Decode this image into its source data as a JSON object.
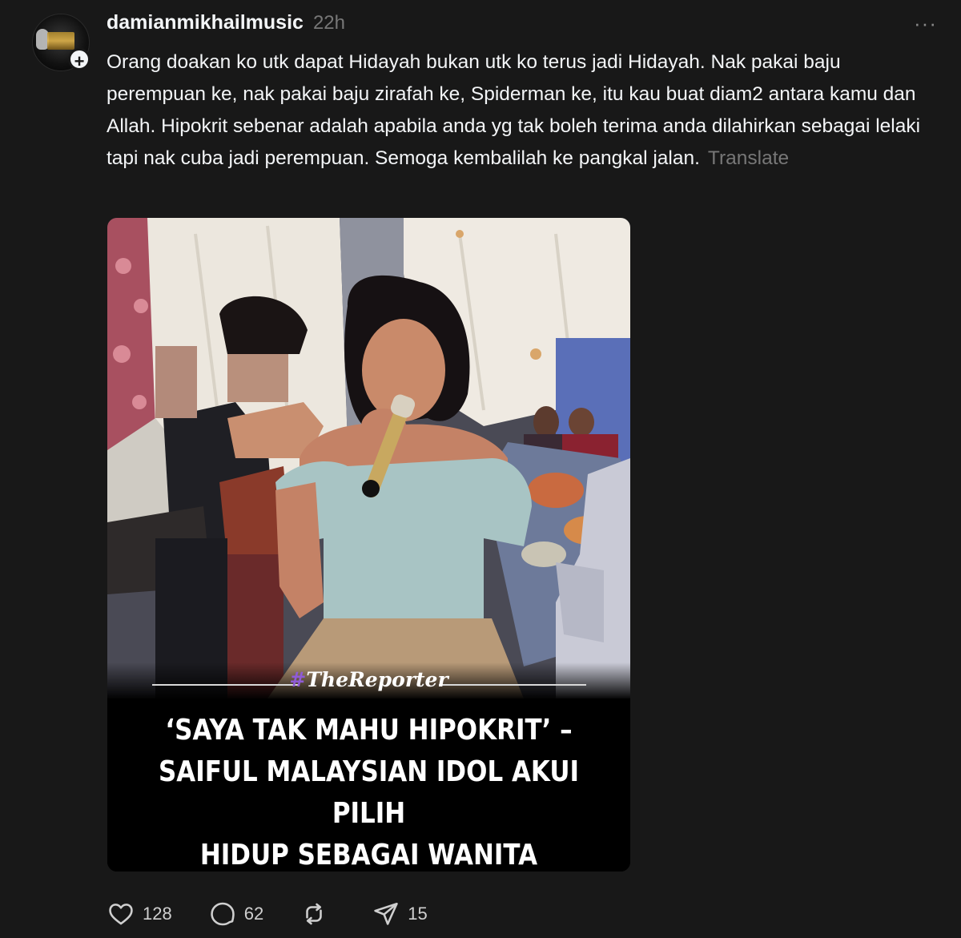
{
  "post": {
    "username": "damianmikhailmusic",
    "time": "22h",
    "more_icon": "···",
    "text": "Orang doakan ko utk dapat Hidayah bukan utk ko terus jadi Hidayah. Nak pakai baju perempuan ke, nak pakai baju zirafah ke, Spiderman ke, itu kau buat diam2 antara kamu dan Allah. Hipokrit sebenar adalah apabila anda yg tak boleh terima anda dilahirkan sebagai lelaki tapi nak cuba jadi perempuan. Semoga kembalilah ke pangkal jalan.",
    "translate_label": "Translate",
    "follow_icon": "+"
  },
  "media": {
    "brand_hash": "#",
    "brand_name": "TheReporter",
    "headline_line1": "‘SAYA TAK MAHU HIPOKRIT’ –",
    "headline_line2": "SAIFUL MALAYSIAN IDOL AKUI PILIH",
    "headline_line3": "HIDUP SEBAGAI WANITA"
  },
  "actions": {
    "likes": "128",
    "replies": "62",
    "reposts": "",
    "shares": "15"
  },
  "icons": [
    "heart-icon",
    "comment-icon",
    "repost-icon",
    "share-icon",
    "more-icon"
  ]
}
